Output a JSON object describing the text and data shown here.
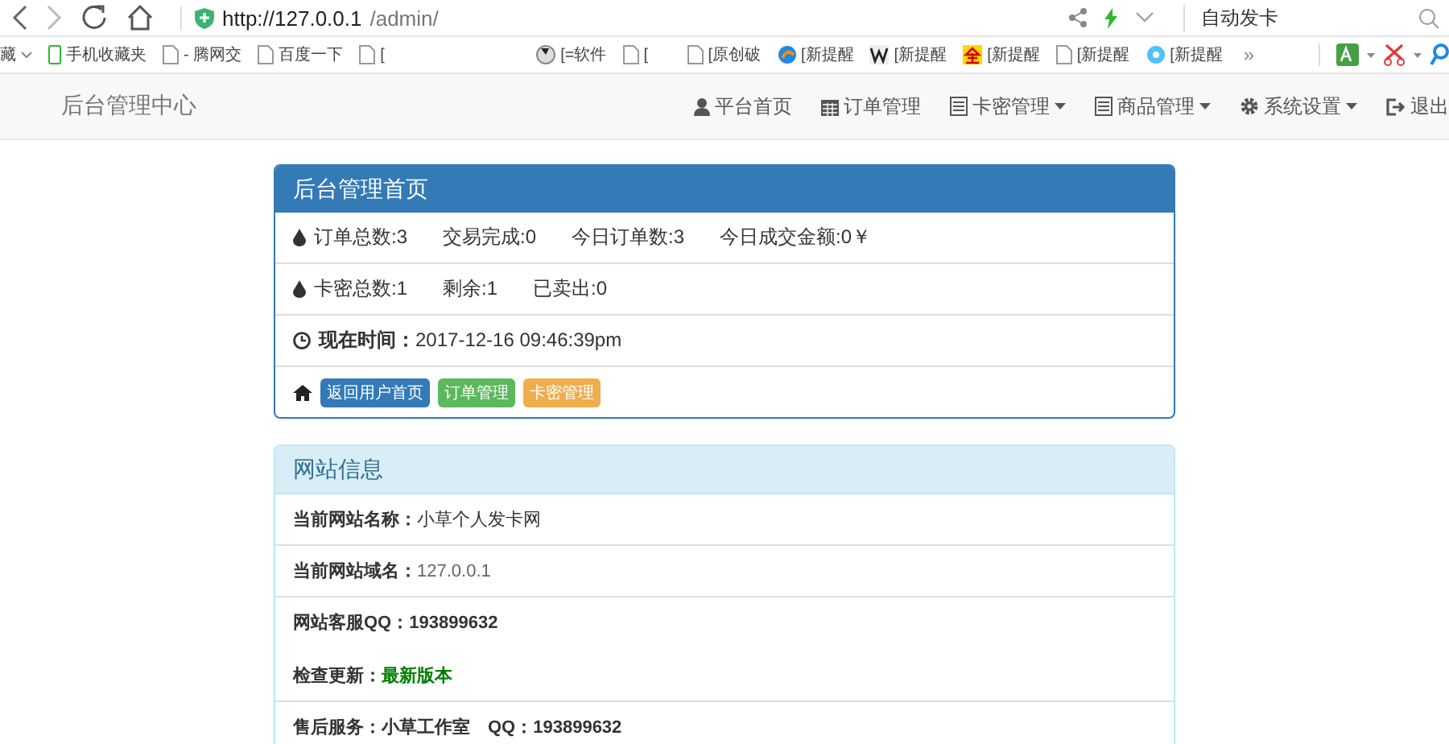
{
  "browser": {
    "url_host": "http://127.0.0.1",
    "url_path": "/admin/",
    "search_value": "自动发卡",
    "bookmarks": [
      {
        "label": "藏",
        "kind": "folder",
        "caret": true
      },
      {
        "label": "手机收藏夹",
        "kind": "phone",
        "caret": false
      },
      {
        "label": "- 腾网交",
        "kind": "page",
        "caret": false
      },
      {
        "label": "百度一下",
        "kind": "page",
        "caret": false
      },
      {
        "label": "[",
        "kind": "page",
        "caret": false
      },
      {
        "label": "[=软件",
        "kind": "disc",
        "caret": false
      },
      {
        "label": "[",
        "kind": "page",
        "caret": false
      },
      {
        "label": "[原创破",
        "kind": "page",
        "caret": false
      },
      {
        "label": "[新提醒",
        "kind": "swirl",
        "caret": false
      },
      {
        "label": "[新提醒",
        "kind": "letter",
        "caret": false
      },
      {
        "label": "[新提醒",
        "kind": "gold",
        "caret": false
      },
      {
        "label": "[新提醒",
        "kind": "page",
        "caret": false
      },
      {
        "label": "[新提醒",
        "kind": "bubble",
        "caret": false
      }
    ],
    "more": "»"
  },
  "navbar": {
    "brand": "后台管理中心",
    "items": [
      {
        "label": "平台首页",
        "kind": "user",
        "dropdown": false
      },
      {
        "label": "订单管理",
        "kind": "calendar",
        "dropdown": false
      },
      {
        "label": "卡密管理",
        "kind": "list",
        "dropdown": true
      },
      {
        "label": "商品管理",
        "kind": "list",
        "dropdown": true
      },
      {
        "label": "系统设置",
        "kind": "gear",
        "dropdown": true
      },
      {
        "label": "退出",
        "kind": "logout",
        "dropdown": false
      }
    ]
  },
  "home_panel": {
    "title": "后台管理首页",
    "rows": [
      {
        "kind": "stats",
        "items": [
          {
            "label": "订单总数:",
            "value": "3"
          },
          {
            "label": "交易完成:",
            "value": "0"
          },
          {
            "label": "今日订单数:",
            "value": "3"
          },
          {
            "label": "今日成交金额:",
            "value": "0￥"
          }
        ]
      },
      {
        "kind": "stats",
        "items": [
          {
            "label": "卡密总数:",
            "value": "1"
          },
          {
            "label": "剩余:",
            "value": "1"
          },
          {
            "label": "已卖出:",
            "value": "0"
          }
        ]
      },
      {
        "kind": "time",
        "label": "现在时间：",
        "value": "2017-12-16 09:46:39pm"
      },
      {
        "kind": "links",
        "buttons": [
          {
            "label": "返回用户首页",
            "color": "#337ab7"
          },
          {
            "label": "订单管理",
            "color": "#5cb85c"
          },
          {
            "label": "卡密管理",
            "color": "#f0ad4e"
          }
        ]
      }
    ]
  },
  "info_panel": {
    "title": "网站信息",
    "rows": [
      {
        "lines": [
          {
            "label": "当前网站名称：",
            "value": "小草个人发卡网",
            "kind": "plain"
          }
        ]
      },
      {
        "lines": [
          {
            "label": "当前网站域名：",
            "value": "127.0.0.1",
            "kind": "muted"
          }
        ]
      },
      {
        "lines": [
          {
            "label": "网站客服QQ：",
            "value": "193899632",
            "kind": "bold"
          },
          {
            "label": "检查更新：",
            "value": "最新版本",
            "kind": "highlight"
          }
        ]
      },
      {
        "lines": [
          {
            "label": "售后服务：",
            "value": "小草工作室　QQ：193899632",
            "kind": "bold"
          }
        ]
      }
    ]
  }
}
